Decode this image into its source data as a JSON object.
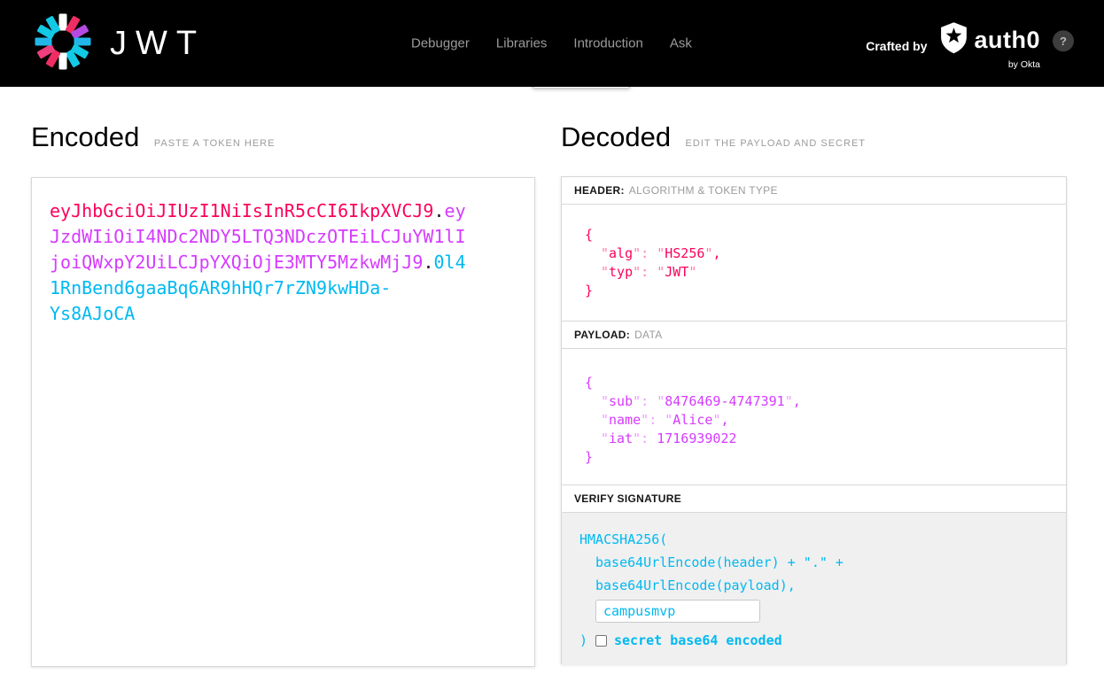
{
  "navbar": {
    "brand": "JWT",
    "links": [
      {
        "label": "Debugger"
      },
      {
        "label": "Libraries"
      },
      {
        "label": "Introduction"
      },
      {
        "label": "Ask"
      }
    ],
    "crafted_by": "Crafted by",
    "auth0_label": "auth0",
    "by_okta": "by Okta",
    "help_label": "?"
  },
  "encoded": {
    "title": "Encoded",
    "subtitle": "PASTE A TOKEN HERE",
    "token": {
      "header": "eyJhbGciOiJIUzI1NiIsInR5cCI6IkpXVCJ9",
      "dot": ".",
      "payload": "eyJzdWIiOiI4NDc2NDY5LTQ3NDczOTEiLCJuYW1lIjoiQWxpY2UiLCJpYXQiOjE3MTY5MzkwMjJ9",
      "signature": "0l41RnBend6gaaBq6AR9hHQr7rZN9kwHDa-Ys8AJoCA"
    }
  },
  "decoded": {
    "title": "Decoded",
    "subtitle": "EDIT THE PAYLOAD AND SECRET",
    "header_section": {
      "label": "HEADER:",
      "sublabel": "ALGORITHM & TOKEN TYPE",
      "open_brace": "{",
      "close_brace": "}",
      "entries": [
        {
          "key": "alg",
          "value": "HS256",
          "comma": ","
        },
        {
          "key": "typ",
          "value": "JWT",
          "comma": ""
        }
      ]
    },
    "payload_section": {
      "label": "PAYLOAD:",
      "sublabel": "DATA",
      "open_brace": "{",
      "close_brace": "}",
      "entries": [
        {
          "key": "sub",
          "value": "8476469-4747391",
          "comma": ","
        },
        {
          "key": "name",
          "value": "Alice",
          "comma": ","
        },
        {
          "key": "iat",
          "value": "1716939022",
          "comma": ""
        }
      ]
    },
    "verify_section": {
      "label": "VERIFY SIGNATURE",
      "code_line1": "HMACSHA256(",
      "code_line2": "base64UrlEncode(header) + \".\" +",
      "code_line3": "base64UrlEncode(payload),",
      "secret_value": "campusmvp",
      "close_paren": ")",
      "checkbox_label": "secret base64 encoded"
    }
  },
  "colors": {
    "header_accent": "#fb015b",
    "payload_accent": "#d63aff",
    "signature_accent": "#00b9f1",
    "navbar_bg": "#000000"
  }
}
